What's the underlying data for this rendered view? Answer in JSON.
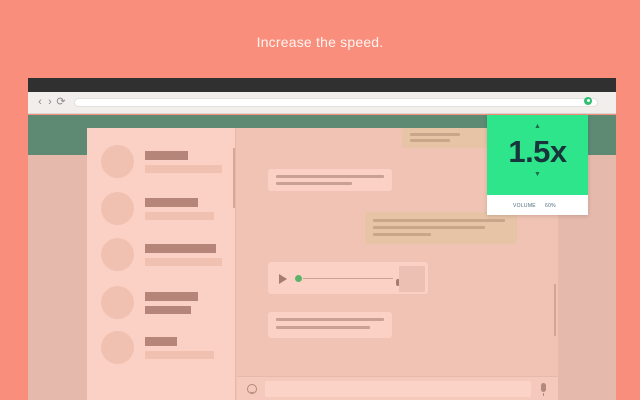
{
  "headline": "Increase the speed.",
  "browser": {
    "nav": {
      "back_icon": "‹",
      "forward_icon": "›",
      "reload_icon": "⟳"
    },
    "extension_icon": "speed-extension-icon"
  },
  "popup": {
    "speed": "1.5x",
    "volume_label": "VOLUME",
    "volume_value": "60%",
    "colors": {
      "panel": "#2ee58b",
      "text": "#17353a"
    }
  },
  "colors": {
    "background": "#f98e7c",
    "page_header": "#5e8a74",
    "accent_green": "#2fbf71"
  }
}
